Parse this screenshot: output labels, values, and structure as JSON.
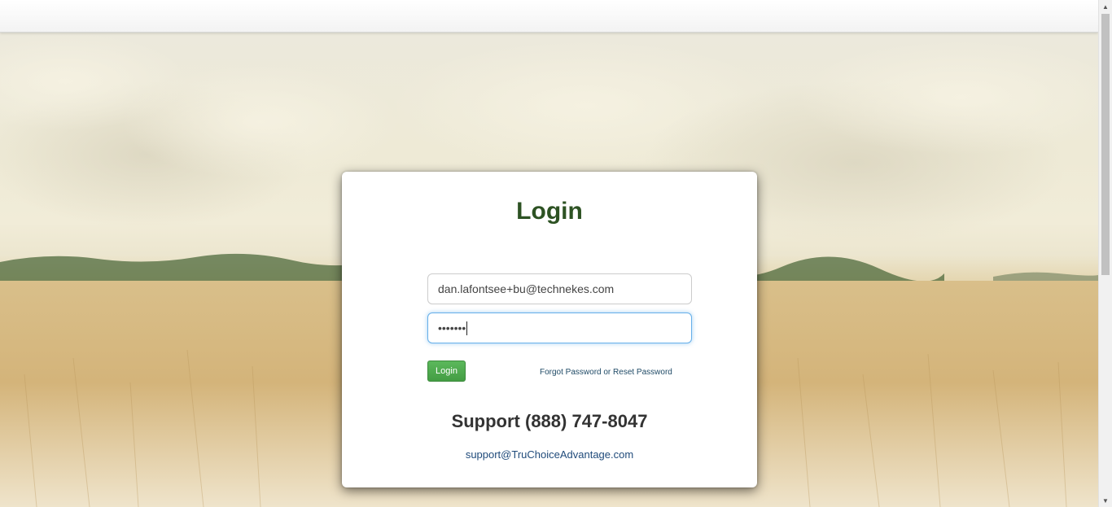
{
  "login": {
    "title": "Login",
    "email_value": "dan.lafontsee+bu@technekes.com",
    "password_mask": "•••••••",
    "login_button_label": "Login",
    "forgot_link": "Forgot Password or Reset Password"
  },
  "support": {
    "phone": "Support (888) 747-8047",
    "email": "support@TruChoiceAdvantage.com"
  },
  "scrollbar": {
    "up_icon": "▲",
    "down_icon": "▼"
  },
  "colors": {
    "title_green": "#2d5223",
    "button_green": "#5cb85c",
    "focus_blue": "#66afe9",
    "link_blue": "#1f4a66"
  }
}
